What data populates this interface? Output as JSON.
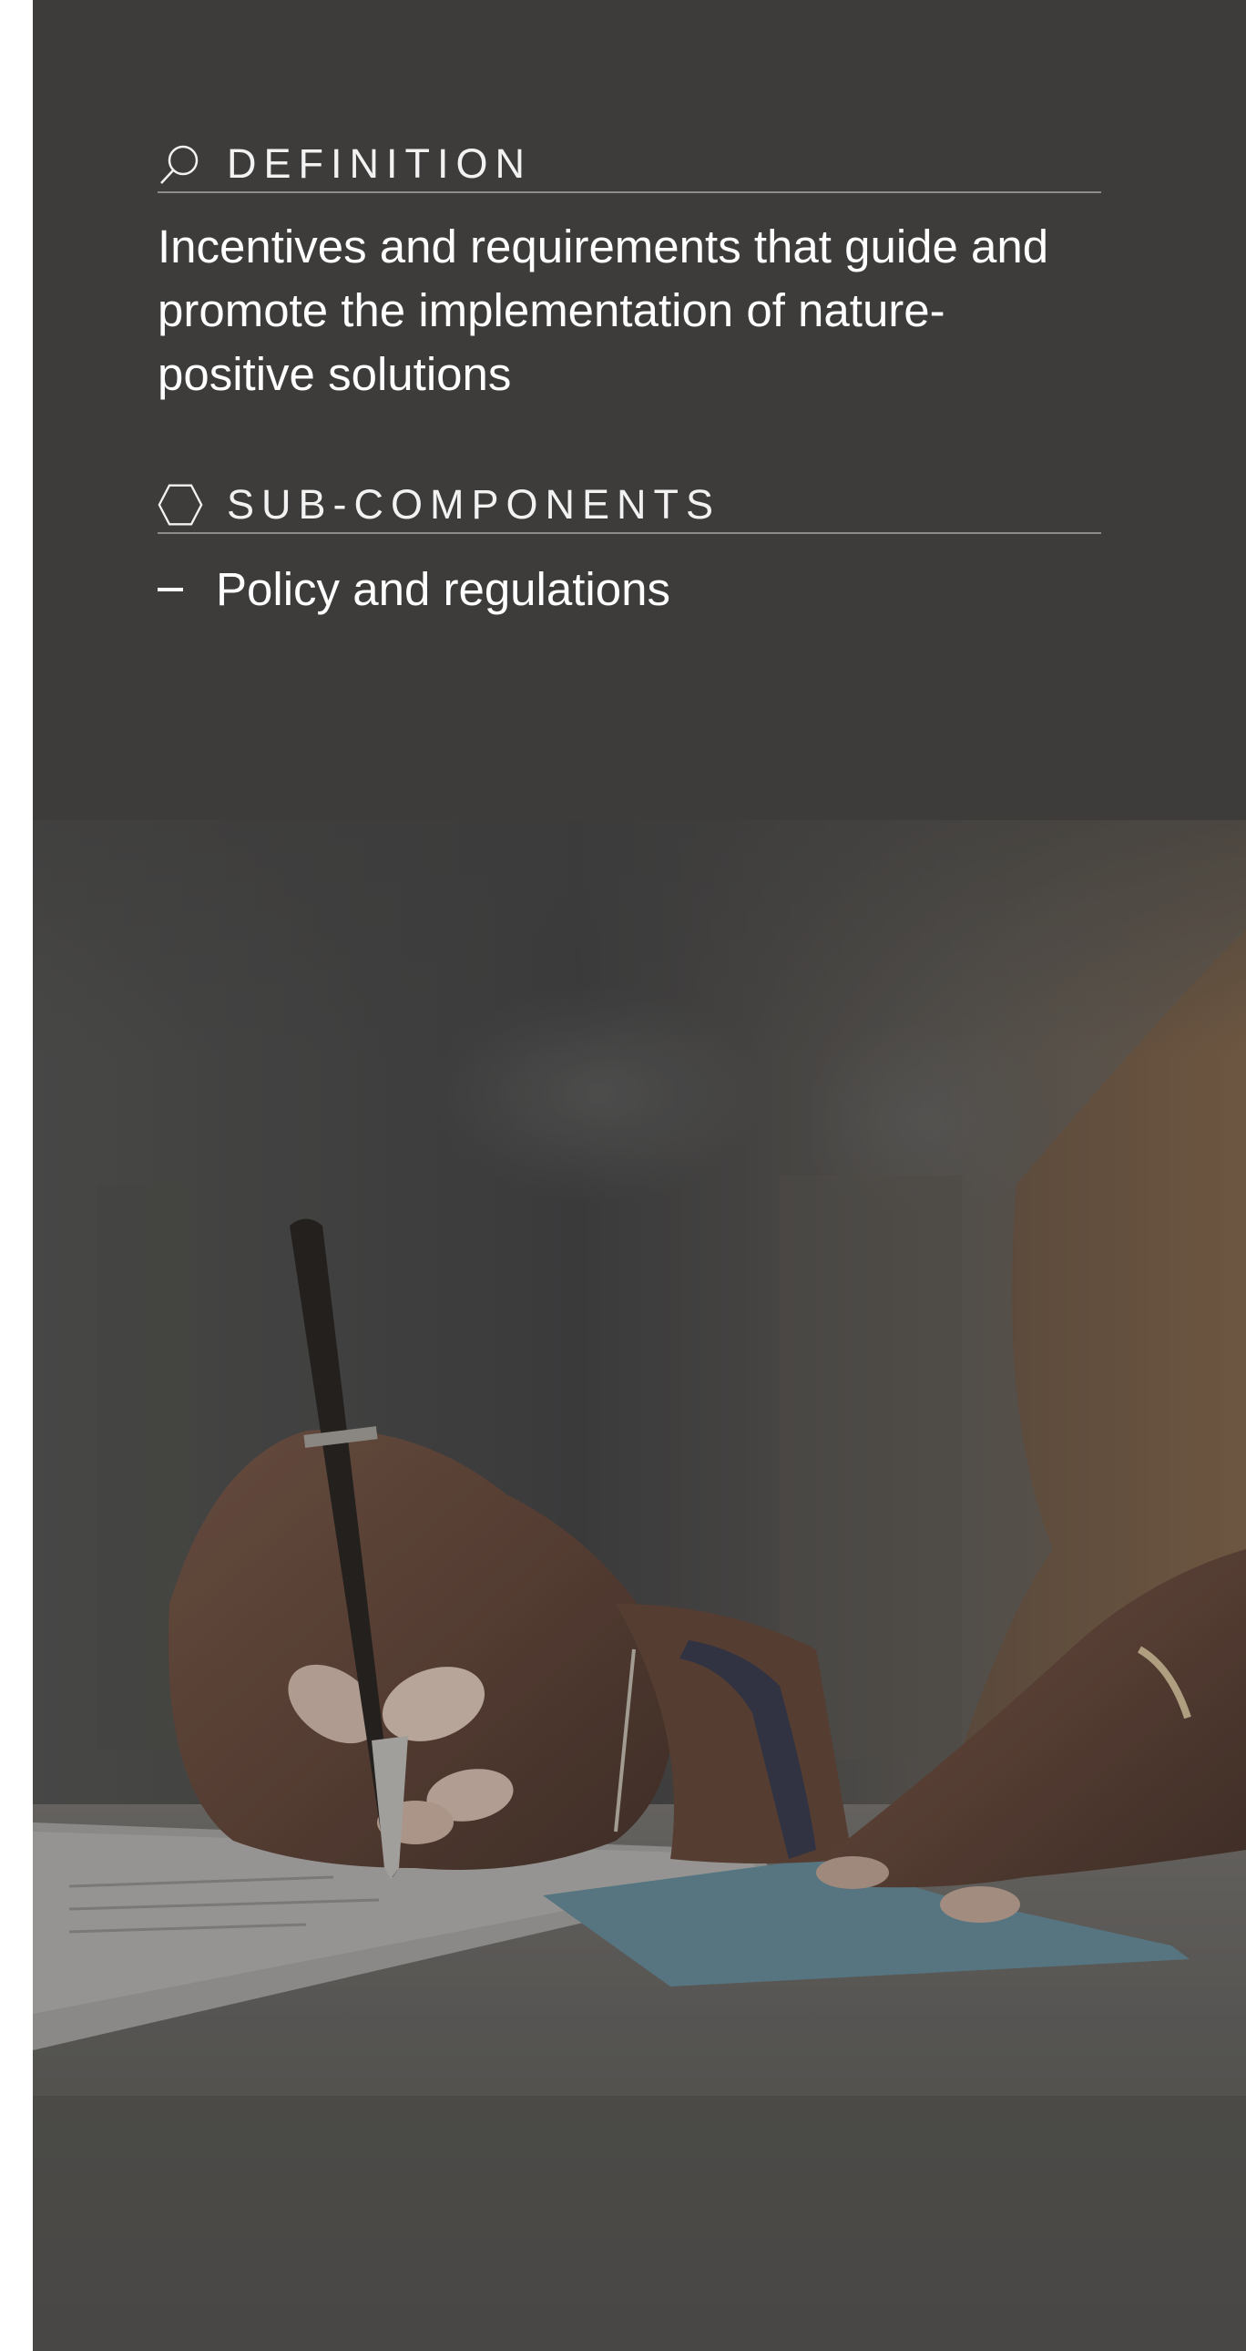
{
  "colors": {
    "panel_background": "#3d3c3b",
    "text": "#ffffff",
    "divider": "#8e8c89"
  },
  "definition": {
    "icon": "magnifier-icon",
    "heading": "DEFINITION",
    "text": "Incentives and requirements that guide and promote the implementation of nature-positive solutions"
  },
  "sub_components": {
    "icon": "hexagon-icon",
    "heading": "SUB-COMPONENTS",
    "items": [
      {
        "label": "Policy and regulations"
      }
    ]
  },
  "background_photo": {
    "subject": "hands-writing-with-pen-photo"
  }
}
